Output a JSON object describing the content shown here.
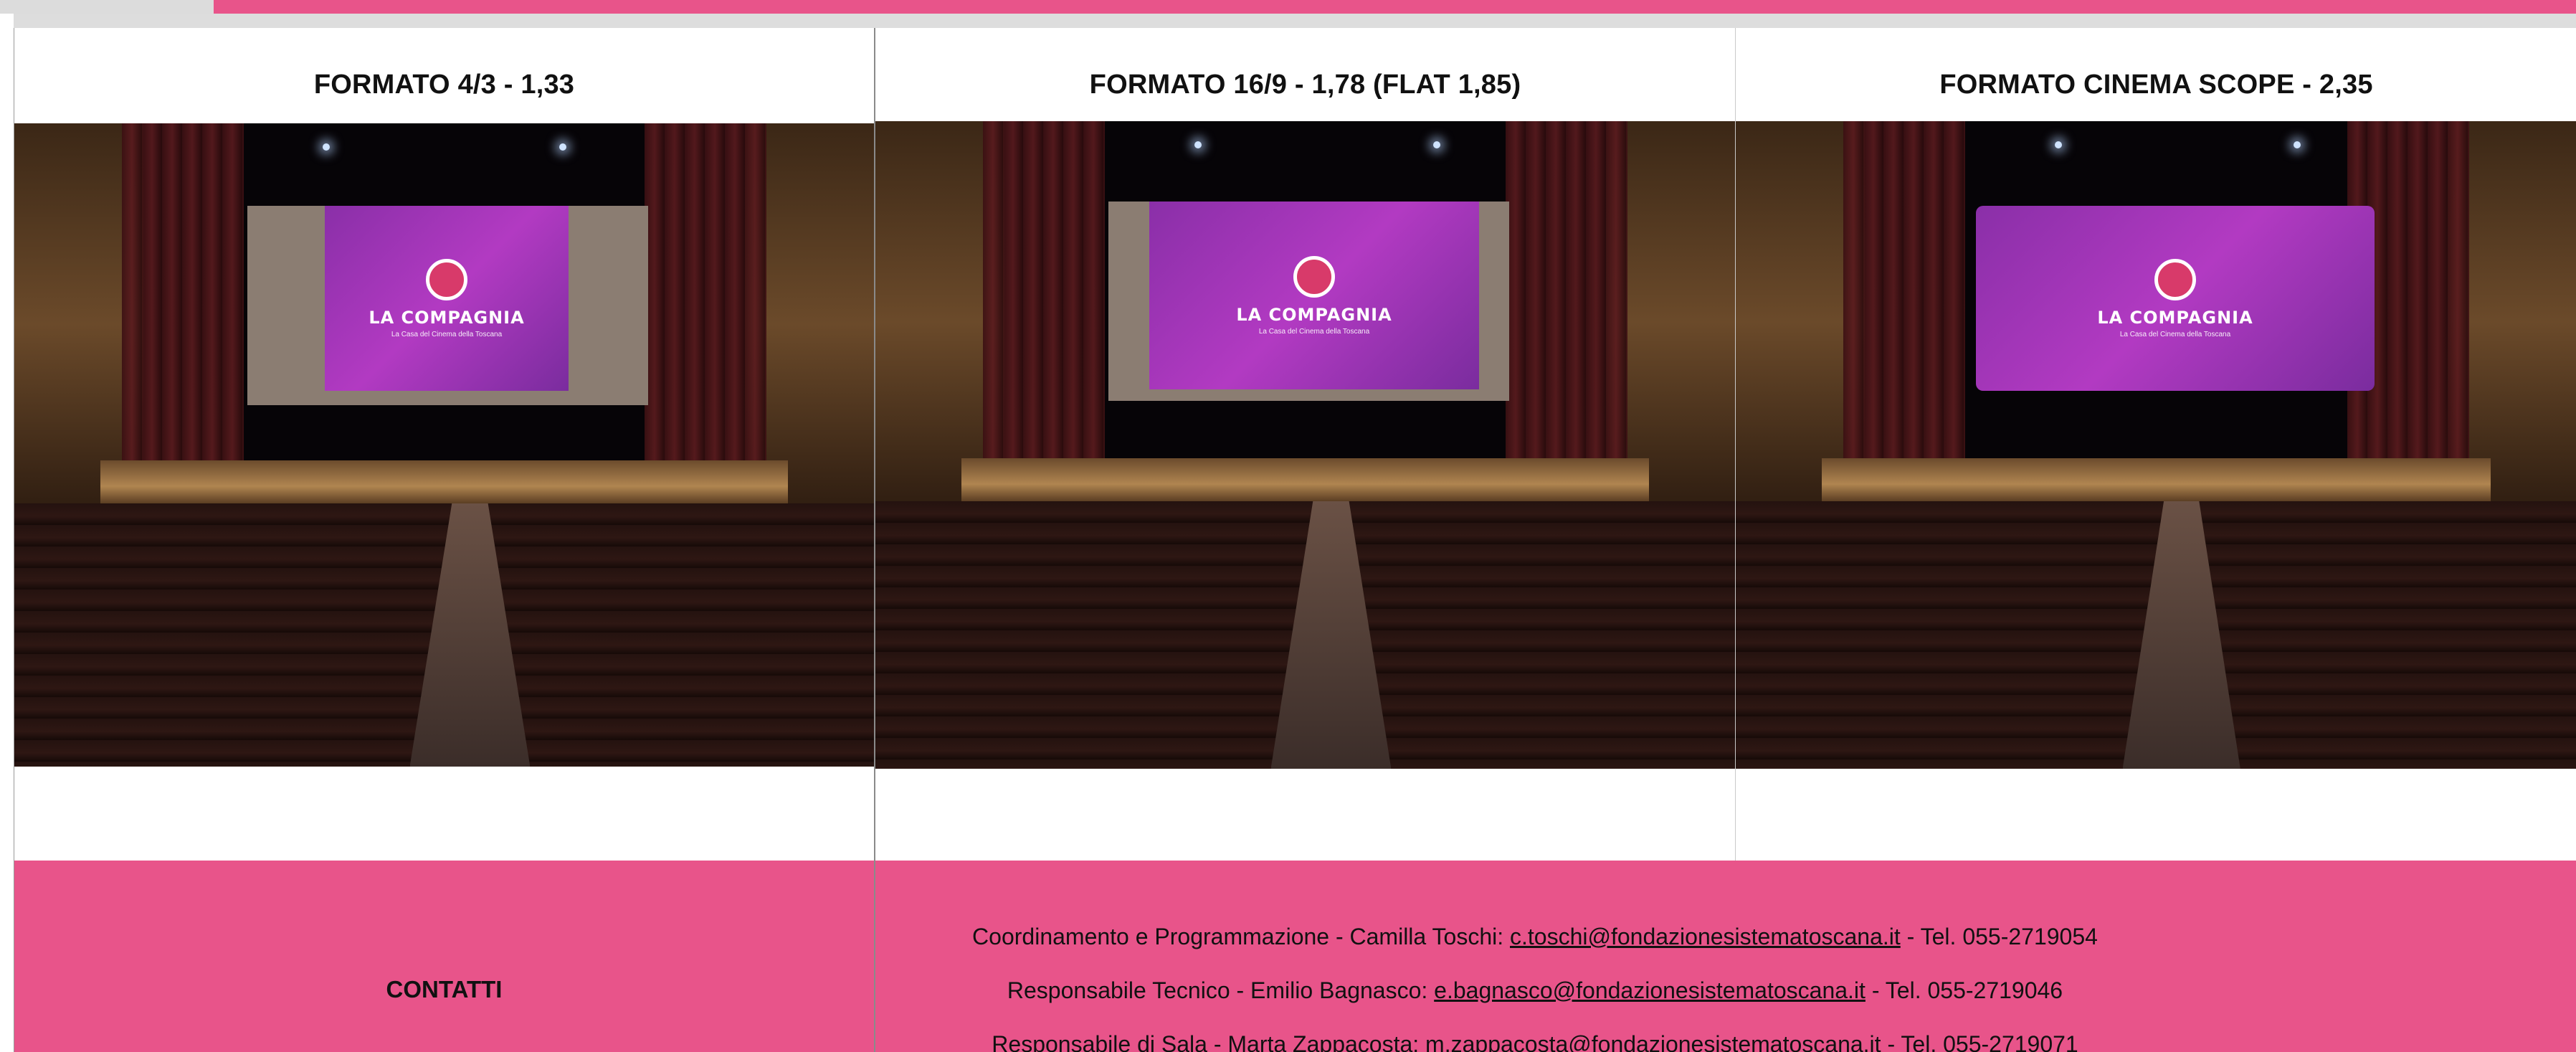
{
  "columns": [
    {
      "title": "FORMATO 4/3 - 1,33",
      "screen": {
        "title": "LA COMPAGNIA",
        "subtitle": "La Casa del Cinema della Toscana"
      }
    },
    {
      "title": "FORMATO 16/9 - 1,78 (FLAT 1,85)",
      "screen": {
        "title": "LA COMPAGNIA",
        "subtitle": "La Casa del Cinema della Toscana"
      }
    },
    {
      "title": "FORMATO CINEMA SCOPE - 2,35",
      "screen": {
        "title": "LA COMPAGNIA",
        "subtitle": "La Casa del Cinema della Toscana"
      }
    }
  ],
  "contacts": {
    "label": "CONTATTI",
    "lines": [
      {
        "prefix": "Coordinamento e Programmazione - Camilla Toschi: ",
        "email": "c.toschi@fondazionesistematoscana.it",
        "suffix": " - Tel. 055-2719054"
      },
      {
        "prefix": "Responsabile Tecnico - Emilio Bagnasco: ",
        "email": "e.bagnasco@fondazionesistematoscana.it",
        "suffix": " - Tel. 055-2719046"
      },
      {
        "prefix": "Responsabile di Sala - Marta Zappacosta: ",
        "email": "m.zappacosta@fondazionesistematoscana.it",
        "suffix": " - Tel. 055-2719071"
      }
    ]
  },
  "colors": {
    "accent_pink": "#e8548a",
    "screen_purple": "#a236be",
    "ruler_grey": "#dddddd"
  }
}
